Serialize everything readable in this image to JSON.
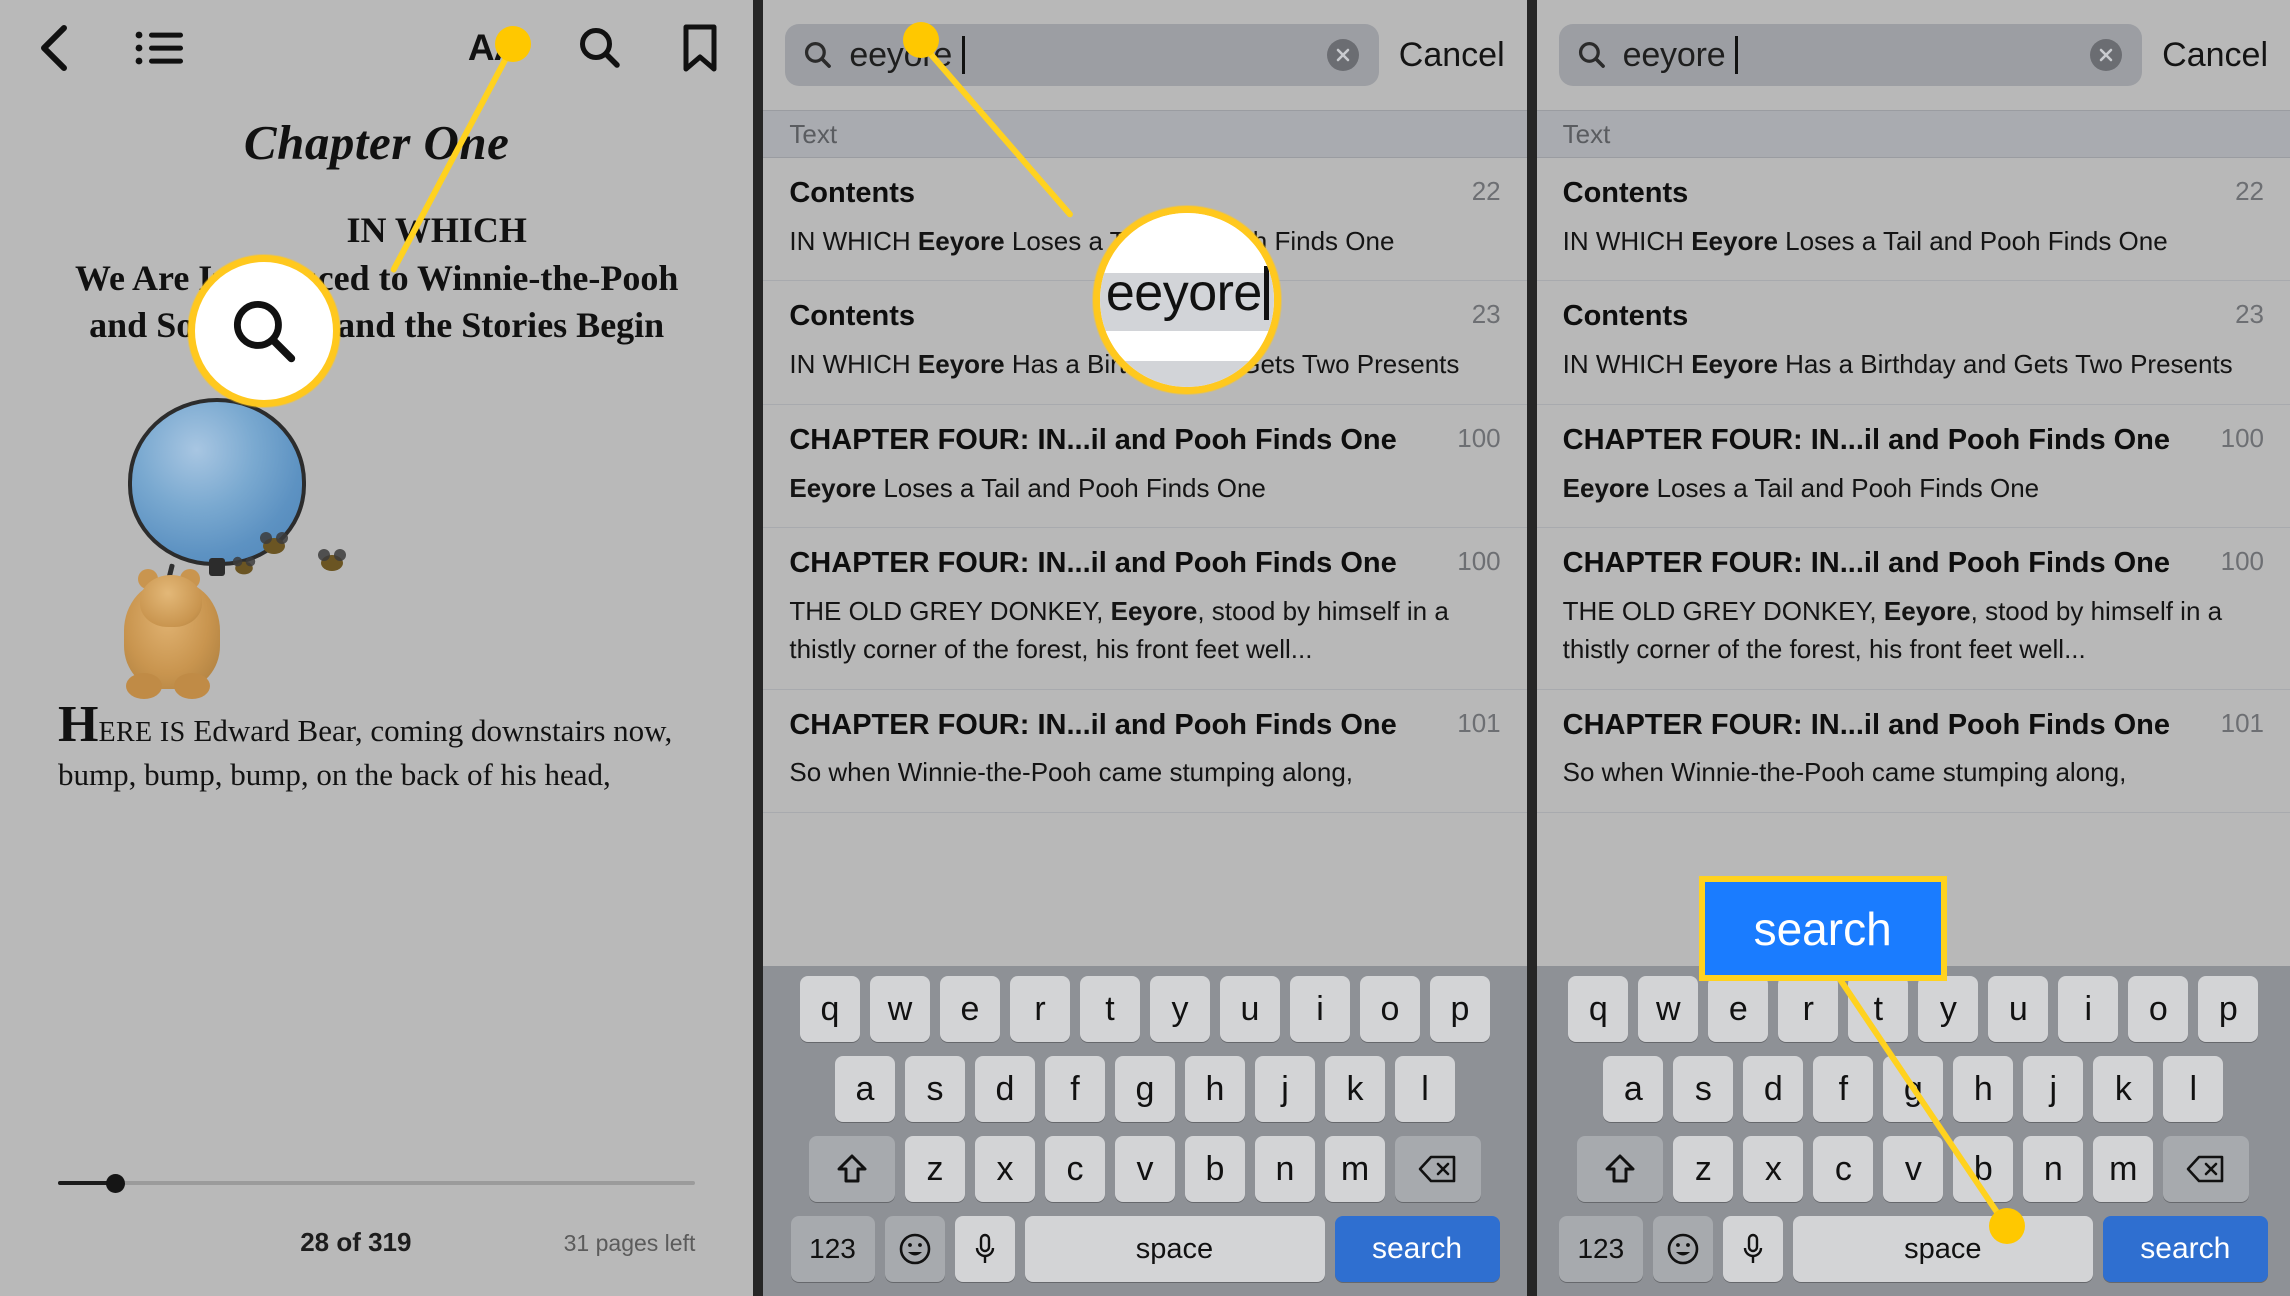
{
  "reader": {
    "toolbar": {
      "back_icon": "chevron-left-icon",
      "contents_icon": "list-bullet-icon",
      "font_size_label": "AA",
      "search_icon": "search-icon",
      "bookmark_icon": "bookmark-icon"
    },
    "chapter_title": "Chapter One",
    "chapter_subtitle_line1": "IN WHICH",
    "chapter_subtitle_line2": "We Are Introduced to Winnie-the-Pooh and Some Bees, and the Stories Begin",
    "body_drop_cap": "H",
    "body_smallcaps": "ERE IS",
    "body_text": " Edward Bear, coming downstairs now, bump, bump, bump, on the back of his head,",
    "page_count": "28 of 319",
    "pages_left": "31 pages left",
    "illustration": "pooh-balloon-bees-illustration"
  },
  "search_panel": {
    "query": "eeyore",
    "search_icon": "search-icon",
    "clear_icon": "clear-circle-icon",
    "cancel_label": "Cancel",
    "section_header": "Text",
    "results": [
      {
        "title": "Contents",
        "page": "22",
        "snippet_pre": "IN WHICH ",
        "snippet_match": "Eeyore",
        "snippet_post": " Loses a Tail and Pooh Finds One"
      },
      {
        "title": "Contents",
        "page": "23",
        "snippet_pre": "IN WHICH ",
        "snippet_match": "Eeyore",
        "snippet_post": " Has a Birthday and Gets Two Presents"
      },
      {
        "title": "CHAPTER FOUR: IN...il and Pooh Finds One",
        "page": "100",
        "snippet_pre": "",
        "snippet_match": "Eeyore",
        "snippet_post": " Loses a Tail and Pooh Finds One"
      },
      {
        "title": "CHAPTER FOUR: IN...il and Pooh Finds One",
        "page": "100",
        "snippet_pre": "THE OLD GREY DONKEY, ",
        "snippet_match": "Eeyore",
        "snippet_post": ", stood by himself in a thistly corner of the forest, his front feet well..."
      },
      {
        "title": "CHAPTER FOUR: IN...il and Pooh Finds One",
        "page": "101",
        "snippet_pre": "",
        "snippet_match": "",
        "snippet_post": "So when Winnie-the-Pooh came stumping along,"
      }
    ]
  },
  "keyboard": {
    "row1": [
      "q",
      "w",
      "e",
      "r",
      "t",
      "y",
      "u",
      "i",
      "o",
      "p"
    ],
    "row2": [
      "a",
      "s",
      "d",
      "f",
      "g",
      "h",
      "j",
      "k",
      "l"
    ],
    "row3": [
      "z",
      "x",
      "c",
      "v",
      "b",
      "n",
      "m"
    ],
    "shift_icon": "shift-arrow-icon",
    "backspace_icon": "backspace-icon",
    "numbers_label": "123",
    "emoji_icon": "emoji-smiley-icon",
    "mic_icon": "microphone-icon",
    "space_label": "space",
    "return_label": "search"
  },
  "annotations": {
    "magnifier_text": "eeyore",
    "callout_label": "search",
    "highlight_color": "#ffc800",
    "callout_fill": "#1a7cff"
  }
}
